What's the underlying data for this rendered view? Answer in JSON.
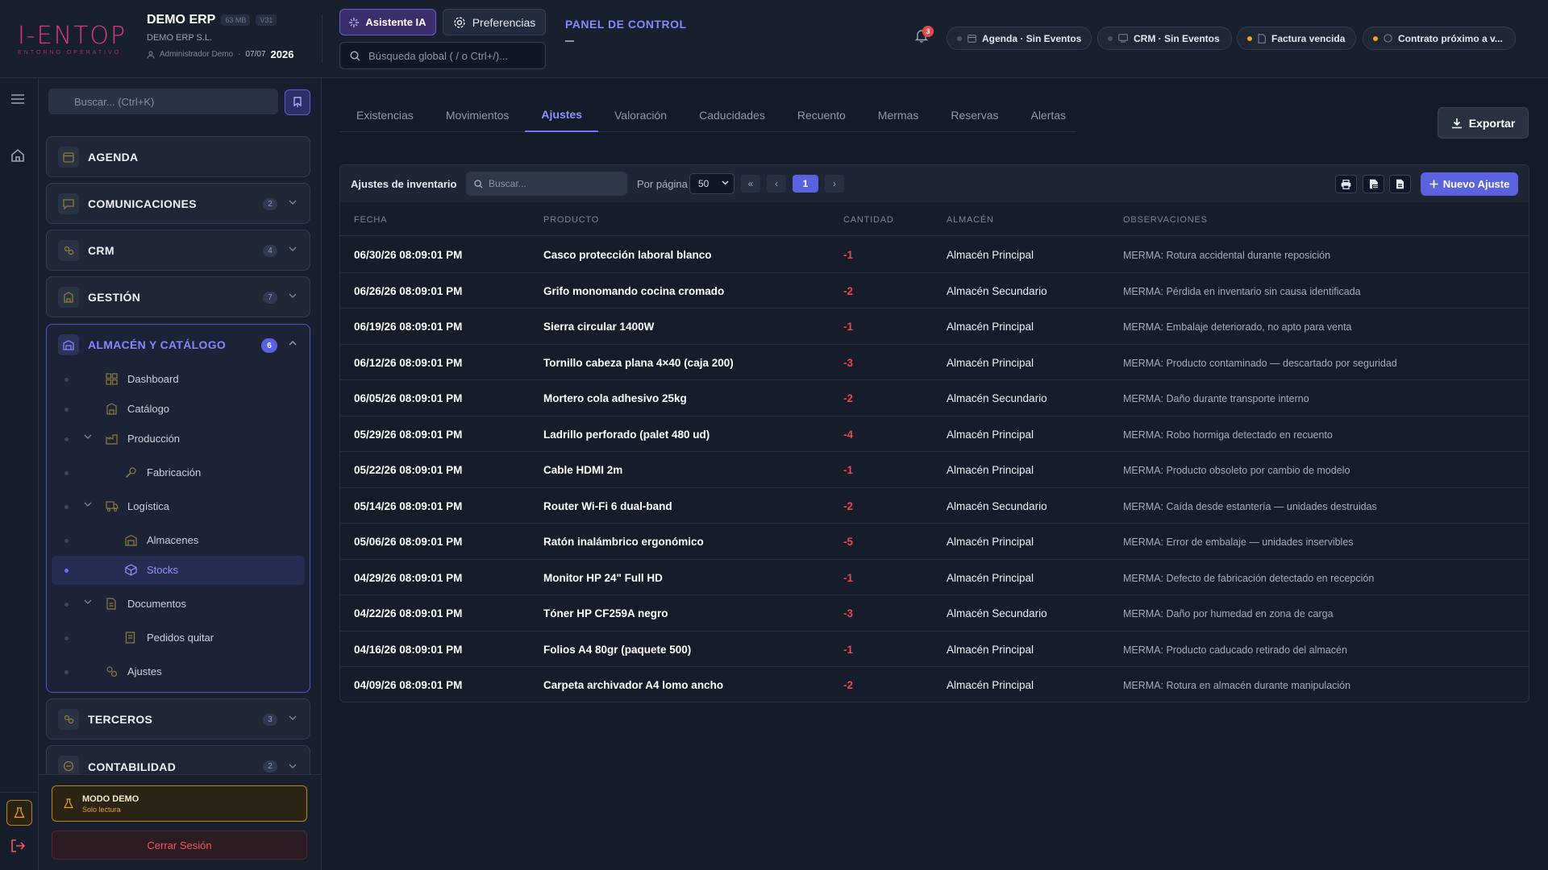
{
  "header": {
    "logo_text": "I-ENTOP",
    "logo_sub": "ENTORNO OPERATIVO",
    "company_name": "DEMO ERP",
    "size_chip": "63 MB",
    "version_chip": "V31",
    "company_legal": "DEMO ERP S.L.",
    "user": "Administrador Demo",
    "date": "07/07",
    "year": "2026",
    "ai_button": "Asistente IA",
    "prefs_button": "Preferencias",
    "search_placeholder": "Búsqueda global ( / o Ctrl+/)...",
    "panel_title": "PANEL DE CONTROL",
    "notif_count": "3",
    "pills": [
      {
        "label": "Agenda · Sin Eventos",
        "icon": "calendar-icon",
        "status": "idle"
      },
      {
        "label": "CRM · Sin Eventos",
        "icon": "crm-icon",
        "status": "idle"
      },
      {
        "label": "Factura vencida",
        "icon": "invoice-icon",
        "status": "warn"
      },
      {
        "label": "Contrato próximo a v...",
        "icon": "contract-icon",
        "status": "warn"
      }
    ]
  },
  "sidebar": {
    "search_placeholder": "Buscar... (Ctrl+K)",
    "sections": [
      {
        "label": "AGENDA",
        "count": ""
      },
      {
        "label": "COMUNICACIONES",
        "count": "2"
      },
      {
        "label": "CRM",
        "count": "4"
      },
      {
        "label": "GESTIÓN",
        "count": "7"
      },
      {
        "label": "TERCEROS",
        "count": "3"
      },
      {
        "label": "CONTABILIDAD",
        "count": "2"
      }
    ],
    "open_section": {
      "label": "ALMACÉN Y CATÁLOGO",
      "count": "6",
      "items": [
        {
          "label": "Dashboard",
          "level": 1
        },
        {
          "label": "Catálogo",
          "level": 1
        },
        {
          "label": "Producción",
          "level": 1,
          "expanded": true
        },
        {
          "label": "Fabricación",
          "level": 2
        },
        {
          "label": "Logística",
          "level": 1,
          "expanded": true
        },
        {
          "label": "Almacenes",
          "level": 2
        },
        {
          "label": "Stocks",
          "level": 2,
          "active": true
        },
        {
          "label": "Documentos",
          "level": 1,
          "expanded": true
        },
        {
          "label": "Pedidos quitar",
          "level": 2
        },
        {
          "label": "Ajustes",
          "level": 1
        }
      ]
    },
    "demo_title": "MODO DEMO",
    "demo_sub": "Solo lectura",
    "logout": "Cerrar Sesión"
  },
  "main": {
    "tabs": [
      "Existencias",
      "Movimientos",
      "Ajustes",
      "Valoración",
      "Caducidades",
      "Recuento",
      "Mermas",
      "Reservas",
      "Alertas"
    ],
    "active_tab": "Ajustes",
    "export_button": "Exportar",
    "table": {
      "title": "Ajustes de inventario",
      "search_placeholder": "Buscar...",
      "per_page_label": "Por página",
      "per_page_value": "50",
      "current_page": "1",
      "new_button": "Nuevo Ajuste",
      "columns": [
        "FECHA",
        "PRODUCTO",
        "CANTIDAD",
        "ALMACÉN",
        "OBSERVACIONES"
      ],
      "rows": [
        [
          "06/30/26 08:09:01 PM",
          "Casco protección laboral blanco",
          "-1",
          "Almacén Principal",
          "MERMA: Rotura accidental durante reposición"
        ],
        [
          "06/26/26 08:09:01 PM",
          "Grifo monomando cocina cromado",
          "-2",
          "Almacén Secundario",
          "MERMA: Pérdida en inventario sin causa identificada"
        ],
        [
          "06/19/26 08:09:01 PM",
          "Sierra circular 1400W",
          "-1",
          "Almacén Principal",
          "MERMA: Embalaje deteriorado, no apto para venta"
        ],
        [
          "06/12/26 08:09:01 PM",
          "Tornillo cabeza plana 4×40 (caja 200)",
          "-3",
          "Almacén Principal",
          "MERMA: Producto contaminado — descartado por seguridad"
        ],
        [
          "06/05/26 08:09:01 PM",
          "Mortero cola adhesivo 25kg",
          "-2",
          "Almacén Secundario",
          "MERMA: Daño durante transporte interno"
        ],
        [
          "05/29/26 08:09:01 PM",
          "Ladrillo perforado (palet 480 ud)",
          "-4",
          "Almacén Principal",
          "MERMA: Robo hormiga detectado en recuento"
        ],
        [
          "05/22/26 08:09:01 PM",
          "Cable HDMI 2m",
          "-1",
          "Almacén Principal",
          "MERMA: Producto obsoleto por cambio de modelo"
        ],
        [
          "05/14/26 08:09:01 PM",
          "Router Wi-Fi 6 dual-band",
          "-2",
          "Almacén Secundario",
          "MERMA: Caída desde estantería — unidades destruidas"
        ],
        [
          "05/06/26 08:09:01 PM",
          "Ratón inalámbrico ergonómico",
          "-5",
          "Almacén Principal",
          "MERMA: Error de embalaje — unidades inservibles"
        ],
        [
          "04/29/26 08:09:01 PM",
          "Monitor HP 24\" Full HD",
          "-1",
          "Almacén Principal",
          "MERMA: Defecto de fabricación detectado en recepción"
        ],
        [
          "04/22/26 08:09:01 PM",
          "Tóner HP CF259A negro",
          "-3",
          "Almacén Secundario",
          "MERMA: Daño por humedad en zona de carga"
        ],
        [
          "04/16/26 08:09:01 PM",
          "Folios A4 80gr (paquete 500)",
          "-1",
          "Almacén Principal",
          "MERMA: Producto caducado retirado del almacén"
        ],
        [
          "04/09/26 08:09:01 PM",
          "Carpeta archivador A4 lomo ancho",
          "-2",
          "Almacén Principal",
          "MERMA: Rotura en almacén durante manipulación"
        ]
      ]
    }
  },
  "colors": {
    "accent": "#5b62e0",
    "negative": "#f0454e",
    "warning": "#f2a417",
    "brand": "#e0358a"
  }
}
